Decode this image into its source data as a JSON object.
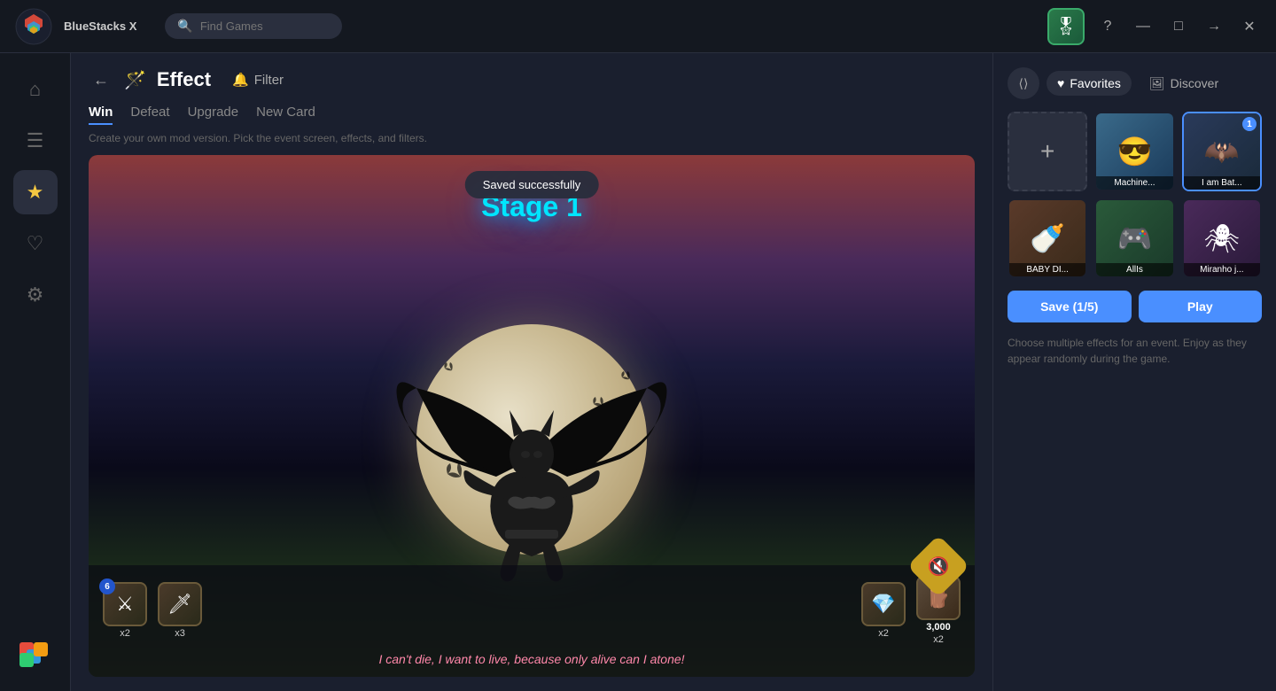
{
  "app": {
    "name": "BlueStacks X",
    "logo_color": "#e74c3c"
  },
  "titlebar": {
    "search_placeholder": "Find Games",
    "help_btn": "?",
    "minimize_btn": "—",
    "maximize_btn": "□",
    "forward_btn": "→",
    "close_btn": "✕"
  },
  "sidebar": {
    "items": [
      {
        "id": "home",
        "icon": "⌂",
        "label": "Home"
      },
      {
        "id": "apps",
        "icon": "☰",
        "label": "My Apps"
      },
      {
        "id": "effects",
        "icon": "★",
        "label": "Effects",
        "active": true
      },
      {
        "id": "favorites",
        "icon": "♡",
        "label": "Favorites"
      },
      {
        "id": "settings",
        "icon": "⚙",
        "label": "Settings"
      }
    ]
  },
  "content": {
    "back_btn": "←",
    "effect_icon": "🪄",
    "title": "Effect",
    "filter_icon": "🔔",
    "filter_label": "Filter",
    "tabs": [
      {
        "id": "win",
        "label": "Win",
        "active": true
      },
      {
        "id": "defeat",
        "label": "Defeat"
      },
      {
        "id": "upgrade",
        "label": "Upgrade"
      },
      {
        "id": "new_card",
        "label": "New Card"
      }
    ],
    "subtitle": "Create your own mod version. Pick the event screen, effects, and filters.",
    "saved_toast": "Saved successfully",
    "stage_text": "Stage 1",
    "game_quote": "I can't die, I want to live, because only alive can I atone!",
    "items": [
      {
        "badge": "6",
        "icon": "⚔",
        "label": "x2"
      },
      {
        "icon": "🗡",
        "label": "x3"
      },
      {
        "icon": "💎",
        "label": "x2"
      },
      {
        "icon": "🪵",
        "count": "3,000",
        "label": "x2"
      }
    ]
  },
  "right_panel": {
    "share_icon": "◈",
    "tabs": [
      {
        "id": "favorites",
        "icon": "♥",
        "label": "Favorites",
        "active": true
      },
      {
        "id": "discover",
        "icon": "🖼",
        "label": "Discover"
      }
    ],
    "presets": [
      {
        "id": "add",
        "type": "add"
      },
      {
        "id": "machine",
        "label": "Machine...",
        "color": "#3a6a8a",
        "emoji": "😎"
      },
      {
        "id": "batman",
        "label": "I am Bat...",
        "color": "#2a3a5a",
        "emoji": "🦇",
        "num": "1",
        "selected": true
      },
      {
        "id": "baby",
        "label": "BABY DI...",
        "color": "#4a3a2a",
        "emoji": "🍼"
      },
      {
        "id": "alls",
        "label": "AllIs",
        "color": "#2a4a3a",
        "emoji": "🎮"
      },
      {
        "id": "miranho",
        "label": "Miranho j...",
        "color": "#3a2a4a",
        "emoji": "🕷"
      }
    ],
    "save_btn": "Save (1/5)",
    "play_btn": "Play",
    "hint": "Choose multiple effects for an event. Enjoy as they appear randomly during the game."
  }
}
